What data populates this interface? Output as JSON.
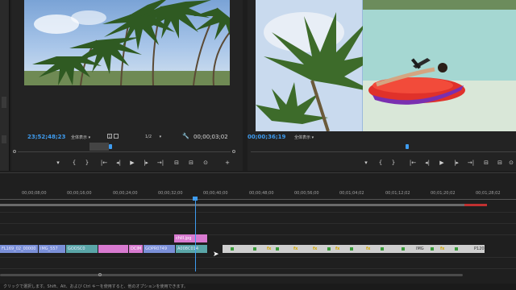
{
  "source_monitor": {
    "timecode": "23;52;48;23",
    "fit_label": "全体表示",
    "resolution_label": "1/2",
    "duration": "00;00;03;02",
    "controls": [
      "▾",
      "{",
      "}",
      "|←",
      "◂|",
      "▶",
      "|▸",
      "→|",
      "⊟",
      "⊟",
      "⊙",
      "+"
    ]
  },
  "program_monitor": {
    "timecode": "00;00;36;19",
    "fit_label": "全体表示",
    "controls": [
      "▾",
      "{",
      "}",
      "|←",
      "◂|",
      "▶",
      "|▸",
      "→|",
      "⊟",
      "⊟",
      "⊙"
    ]
  },
  "timeline": {
    "ruler_labels": [
      "00;00;08;00",
      "00;00;16;00",
      "00;00;24;00",
      "00;00;32;00",
      "00;00;40;00",
      "00;00;48;00",
      "00;00;56;00",
      "00;01;04;02",
      "00;01;12;02",
      "00;01;20;02",
      "00;01;28;02"
    ],
    "upper_clip": "chill.jpg",
    "clips": [
      {
        "label": "FL169_02_00000",
        "style": "blue"
      },
      {
        "label": "IMG_557",
        "style": "blue"
      },
      {
        "label": "GOOSC0",
        "style": "teal"
      },
      {
        "label": "",
        "style": "pink"
      },
      {
        "label": "DCIM",
        "style": "pink"
      },
      {
        "label": "GOPR0749",
        "style": "blue"
      },
      {
        "label": "A008C014",
        "style": "teal"
      }
    ],
    "right_clip_labels": [
      "IMG",
      "P120"
    ]
  },
  "status_bar": {
    "text": "クリックで選択します。Shift、Alt、および Ctrl キーを使用すると、他のオプションを使用できます。"
  },
  "colors": {
    "accent": "#3e9cf0",
    "pink_clip": "#d87ad0",
    "blue_clip": "#7a8fd8",
    "kayak": "#e0312a"
  },
  "icons": {
    "wrench": "wrench-icon",
    "marker": "marker-icon",
    "play": "play-icon",
    "camera": "camera-icon"
  }
}
